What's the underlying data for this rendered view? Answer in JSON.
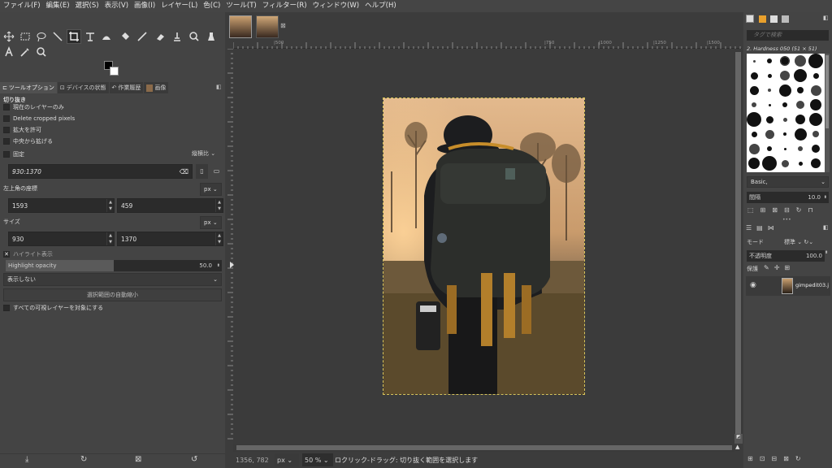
{
  "menu": [
    "ファイル(F)",
    "編集(E)",
    "選択(S)",
    "表示(V)",
    "画像(I)",
    "レイヤー(L)",
    "色(C)",
    "ツール(T)",
    "フィルター(R)",
    "ウィンドウ(W)",
    "ヘルプ(H)"
  ],
  "dock_tabs": [
    "ツールオプション",
    "デバイスの状態",
    "作業履歴",
    "画像"
  ],
  "tool_options": {
    "title": "切り抜き",
    "current_layer_only": "現在のレイヤーのみ",
    "delete_cropped": "Delete cropped pixels",
    "allow_growing": "拡大を許可",
    "expand_from_center": "中央から拡げる",
    "fixed_label": "固定",
    "fixed_mode": "縦横比",
    "ratio_value": "930:1370",
    "position_label": "左上角の座標",
    "position_unit": "px",
    "pos_x": "1593",
    "pos_y": "459",
    "size_label": "サイズ",
    "size_unit": "px",
    "size_w": "930",
    "size_h": "1370",
    "highlight_label": "ハイライト表示",
    "highlight_opacity_label": "Highlight opacity",
    "highlight_opacity_value": "50.0",
    "highlight_opacity_fraction": 0.5,
    "guides": "表示しない",
    "auto_shrink": "選択範囲の自動縮小",
    "shrink_merged": "すべての可視レイヤーを対象にする"
  },
  "ruler_labels": [
    "|500",
    "|750",
    "|1000",
    "|1250",
    "|1500"
  ],
  "status": {
    "coords": "1356, 782",
    "unit": "px",
    "zoom": "50 %",
    "message": "ロクリック-ドラッグ: 切り抜く範囲を選択します"
  },
  "brushes": {
    "filter_placeholder": "タグで検索",
    "current": "2. Hardness 050 (51 × 51)",
    "preset": "Basic,",
    "spacing_label": "間隔",
    "spacing_value": "10.0"
  },
  "layers": {
    "mode_label": "モード",
    "mode_value": "標準",
    "opacity_label": "不透明度",
    "opacity_value": "100.0",
    "lock_label": "保護",
    "layer_name": "gimpedit03.j"
  },
  "colors": {
    "accent_selection": "#d8c45a",
    "ui_bg": "#444444"
  }
}
